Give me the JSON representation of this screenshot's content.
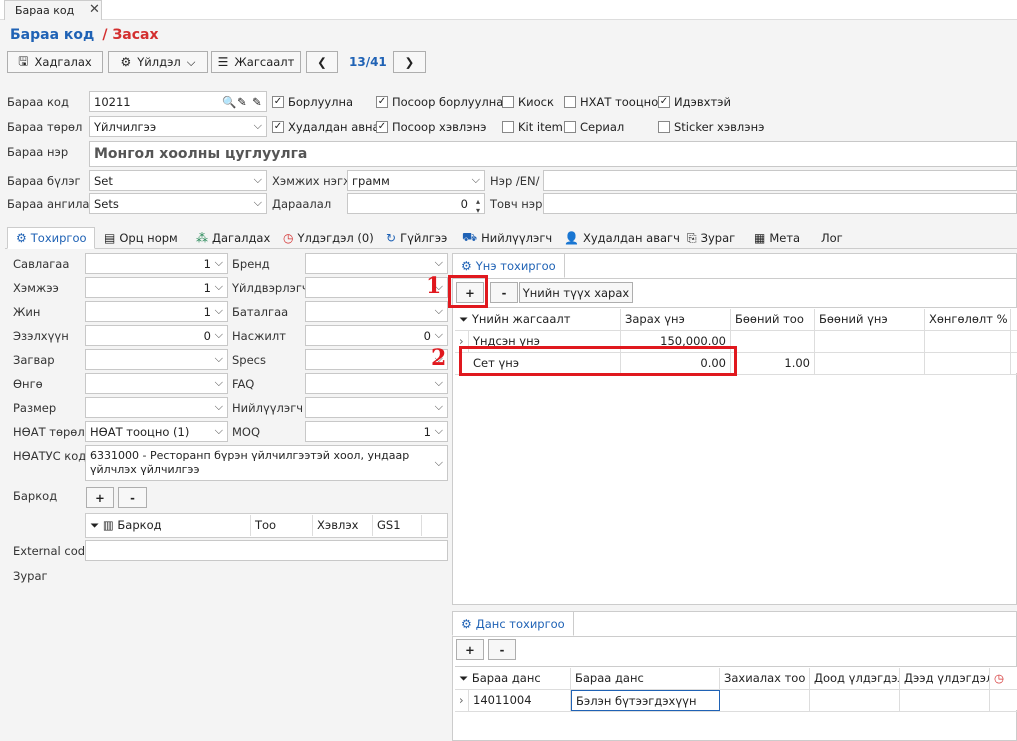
{
  "window": {
    "tab_title": "Бараа код",
    "close": "✕"
  },
  "header": {
    "title": "Бараа код",
    "mode": "/ Засах"
  },
  "toolbar": {
    "save": "Хадгалах",
    "action": "Үйлдэл",
    "list": "Жагсаалт",
    "page": "13/41"
  },
  "form": {
    "code_label": "Бараа код",
    "code_value": "10211",
    "type_label": "Бараа төрөл",
    "type_value": "Үйлчилгээ",
    "name_label": "Бараа нэр",
    "name_value": "Монгол хоолны цуглуулга",
    "group_label": "Бараа бүлэг",
    "group_value": "Set",
    "category_label": "Бараа ангилал",
    "category_value": "Sets",
    "unit_label": "Хэмжих нэгж",
    "unit_value": "грамм",
    "order_label": "Дараалал",
    "order_value": "0",
    "name_en_label": "Нэр /EN/",
    "short_label": "Товч нэр"
  },
  "checkboxes": {
    "sold": "Борлуулна",
    "sold_pos": "Посоор борлуулна",
    "kiosk": "Киоск",
    "vat": "НХАТ тооцно",
    "active": "Идэвхтэй",
    "bought": "Худалдан авна",
    "consumed_pos": "Посоор хэвлэнэ",
    "kit": "Kit item",
    "serial": "Сериал",
    "sticker": "Sticker хэвлэнэ"
  },
  "subtabs": [
    "Тохиргоо",
    "Орц норм",
    "Дагалдах",
    "Үлдэгдэл (0)",
    "Гүйлгээ",
    "Нийлүүлэгч",
    "Худалдан авагч",
    "Зураг",
    "Мета",
    "Лог"
  ],
  "settings": {
    "pack_label": "Савлагаа",
    "pack_value": "1",
    "size_label": "Хэмжээ",
    "size_value": "1",
    "weight_label": "Жин",
    "weight_value": "1",
    "volume_label": "Эзэлхүүн",
    "volume_value": "0",
    "model_label": "Загвар",
    "color_label": "Өнгө",
    "dim_label": "Размер",
    "vat_type_label": "НӨАТ төрөл",
    "vat_type_value": "НӨАТ тооцно (1)",
    "vatus_label": "НӨАТУС код",
    "vatus_value": "6331000 - Ресторанп бүрэн үйлчилгээтэй хоол, ундаар үйлчлэх үйлчилгээ",
    "barcode_label": "Баркод",
    "external_label": "External code",
    "image_label": "Зураг",
    "brand_label": "Бренд",
    "maker_label": "Үйлдвэрлэгч",
    "warranty_label": "Баталгаа",
    "moisture_label": "Насжилт",
    "moisture_value": "0",
    "specs_label": "Specs",
    "faq_label": "FAQ",
    "supplier_label": "Нийлүүлэгч",
    "moq_label": "MOQ",
    "moq_value": "1"
  },
  "barcode_grid": {
    "cols": [
      "Баркод",
      "Тоо",
      "Хэвлэх",
      "GS1"
    ]
  },
  "price": {
    "tab": "Үнэ тохиргоо",
    "plus": "+",
    "minus": "-",
    "history": "Үнийн түүх харах",
    "cols": [
      "Үнийн жагсаалт",
      "Зарах үнэ",
      "Бөөний тоо",
      "Бөөний үнэ",
      "Хөнгөлөлт %"
    ],
    "rows": [
      {
        "name": "Үндсэн үнэ",
        "price": "150,000.00",
        "qty": "",
        "wp": "",
        "disc": ""
      },
      {
        "name": "Сет үнэ",
        "price": "0.00",
        "qty": "1.00",
        "wp": "",
        "disc": ""
      }
    ]
  },
  "account": {
    "tab": "Данс тохиргоо",
    "plus": "+",
    "minus": "-",
    "cols": [
      "Бараа данс",
      "Бараа данс",
      "Захиалах тоо",
      "Доод үлдэгдэл",
      "Дээд үлдэгдэл"
    ],
    "rows": [
      {
        "code": "14011004",
        "name": "Бэлэн бүтээгдэхүүн"
      }
    ]
  },
  "annotations": {
    "m1": "1",
    "m2": "2"
  },
  "colors": {
    "accent": "#1f62b5",
    "mode": "#d32f2f",
    "highlight": "#e0181e"
  }
}
